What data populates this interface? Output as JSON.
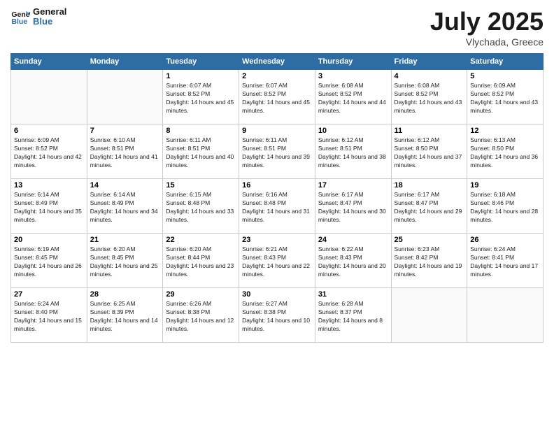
{
  "logo": {
    "line1": "General",
    "line2": "Blue"
  },
  "title": "July 2025",
  "subtitle": "Vlychada, Greece",
  "weekdays": [
    "Sunday",
    "Monday",
    "Tuesday",
    "Wednesday",
    "Thursday",
    "Friday",
    "Saturday"
  ],
  "weeks": [
    [
      {
        "day": "",
        "info": ""
      },
      {
        "day": "",
        "info": ""
      },
      {
        "day": "1",
        "info": "Sunrise: 6:07 AM\nSunset: 8:52 PM\nDaylight: 14 hours and 45 minutes."
      },
      {
        "day": "2",
        "info": "Sunrise: 6:07 AM\nSunset: 8:52 PM\nDaylight: 14 hours and 45 minutes."
      },
      {
        "day": "3",
        "info": "Sunrise: 6:08 AM\nSunset: 8:52 PM\nDaylight: 14 hours and 44 minutes."
      },
      {
        "day": "4",
        "info": "Sunrise: 6:08 AM\nSunset: 8:52 PM\nDaylight: 14 hours and 43 minutes."
      },
      {
        "day": "5",
        "info": "Sunrise: 6:09 AM\nSunset: 8:52 PM\nDaylight: 14 hours and 43 minutes."
      }
    ],
    [
      {
        "day": "6",
        "info": "Sunrise: 6:09 AM\nSunset: 8:52 PM\nDaylight: 14 hours and 42 minutes."
      },
      {
        "day": "7",
        "info": "Sunrise: 6:10 AM\nSunset: 8:51 PM\nDaylight: 14 hours and 41 minutes."
      },
      {
        "day": "8",
        "info": "Sunrise: 6:11 AM\nSunset: 8:51 PM\nDaylight: 14 hours and 40 minutes."
      },
      {
        "day": "9",
        "info": "Sunrise: 6:11 AM\nSunset: 8:51 PM\nDaylight: 14 hours and 39 minutes."
      },
      {
        "day": "10",
        "info": "Sunrise: 6:12 AM\nSunset: 8:51 PM\nDaylight: 14 hours and 38 minutes."
      },
      {
        "day": "11",
        "info": "Sunrise: 6:12 AM\nSunset: 8:50 PM\nDaylight: 14 hours and 37 minutes."
      },
      {
        "day": "12",
        "info": "Sunrise: 6:13 AM\nSunset: 8:50 PM\nDaylight: 14 hours and 36 minutes."
      }
    ],
    [
      {
        "day": "13",
        "info": "Sunrise: 6:14 AM\nSunset: 8:49 PM\nDaylight: 14 hours and 35 minutes."
      },
      {
        "day": "14",
        "info": "Sunrise: 6:14 AM\nSunset: 8:49 PM\nDaylight: 14 hours and 34 minutes."
      },
      {
        "day": "15",
        "info": "Sunrise: 6:15 AM\nSunset: 8:48 PM\nDaylight: 14 hours and 33 minutes."
      },
      {
        "day": "16",
        "info": "Sunrise: 6:16 AM\nSunset: 8:48 PM\nDaylight: 14 hours and 31 minutes."
      },
      {
        "day": "17",
        "info": "Sunrise: 6:17 AM\nSunset: 8:47 PM\nDaylight: 14 hours and 30 minutes."
      },
      {
        "day": "18",
        "info": "Sunrise: 6:17 AM\nSunset: 8:47 PM\nDaylight: 14 hours and 29 minutes."
      },
      {
        "day": "19",
        "info": "Sunrise: 6:18 AM\nSunset: 8:46 PM\nDaylight: 14 hours and 28 minutes."
      }
    ],
    [
      {
        "day": "20",
        "info": "Sunrise: 6:19 AM\nSunset: 8:45 PM\nDaylight: 14 hours and 26 minutes."
      },
      {
        "day": "21",
        "info": "Sunrise: 6:20 AM\nSunset: 8:45 PM\nDaylight: 14 hours and 25 minutes."
      },
      {
        "day": "22",
        "info": "Sunrise: 6:20 AM\nSunset: 8:44 PM\nDaylight: 14 hours and 23 minutes."
      },
      {
        "day": "23",
        "info": "Sunrise: 6:21 AM\nSunset: 8:43 PM\nDaylight: 14 hours and 22 minutes."
      },
      {
        "day": "24",
        "info": "Sunrise: 6:22 AM\nSunset: 8:43 PM\nDaylight: 14 hours and 20 minutes."
      },
      {
        "day": "25",
        "info": "Sunrise: 6:23 AM\nSunset: 8:42 PM\nDaylight: 14 hours and 19 minutes."
      },
      {
        "day": "26",
        "info": "Sunrise: 6:24 AM\nSunset: 8:41 PM\nDaylight: 14 hours and 17 minutes."
      }
    ],
    [
      {
        "day": "27",
        "info": "Sunrise: 6:24 AM\nSunset: 8:40 PM\nDaylight: 14 hours and 15 minutes."
      },
      {
        "day": "28",
        "info": "Sunrise: 6:25 AM\nSunset: 8:39 PM\nDaylight: 14 hours and 14 minutes."
      },
      {
        "day": "29",
        "info": "Sunrise: 6:26 AM\nSunset: 8:38 PM\nDaylight: 14 hours and 12 minutes."
      },
      {
        "day": "30",
        "info": "Sunrise: 6:27 AM\nSunset: 8:38 PM\nDaylight: 14 hours and 10 minutes."
      },
      {
        "day": "31",
        "info": "Sunrise: 6:28 AM\nSunset: 8:37 PM\nDaylight: 14 hours and 8 minutes."
      },
      {
        "day": "",
        "info": ""
      },
      {
        "day": "",
        "info": ""
      }
    ]
  ]
}
